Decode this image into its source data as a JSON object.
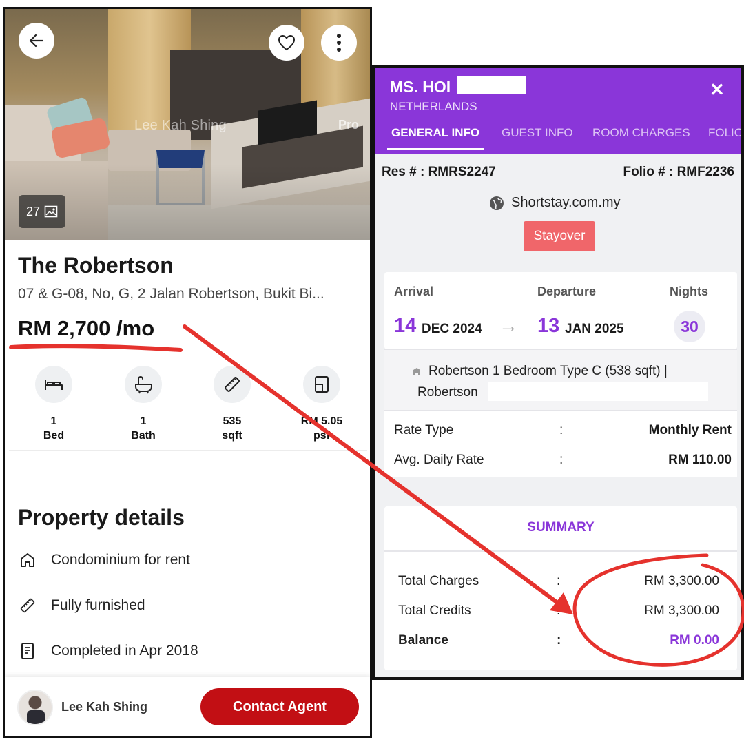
{
  "listing": {
    "photo_watermark": "Lee Kah Shing",
    "photo_brand": "Pro",
    "photo_count": "27",
    "title": "The Robertson",
    "address": "07 & G-08, No, G, 2 Jalan Robertson, Bukit Bi...",
    "price": "RM 2,700 /mo",
    "features": [
      {
        "icon": "bed-icon",
        "value": "1",
        "label": "Bed"
      },
      {
        "icon": "bath-icon",
        "value": "1",
        "label": "Bath"
      },
      {
        "icon": "ruler-icon",
        "value": "535",
        "label": "sqft"
      },
      {
        "icon": "floorplan-icon",
        "value": "RM 5.05",
        "label": "psf"
      }
    ],
    "details_heading": "Property details",
    "details": [
      {
        "icon": "home-icon",
        "text": "Condominium for rent"
      },
      {
        "icon": "ruler-icon",
        "text": "Fully furnished"
      },
      {
        "icon": "document-icon",
        "text": "Completed in Apr 2018"
      }
    ],
    "agent_name": "Lee Kah Shing",
    "contact_label": "Contact Agent"
  },
  "booking": {
    "guest_name": "MS. HOI",
    "guest_country": "NETHERLANDS",
    "close_label": "✕",
    "tabs": [
      "GENERAL INFO",
      "GUEST INFO",
      "ROOM CHARGES",
      "FOLIO"
    ],
    "active_tab": "GENERAL INFO",
    "res_no": "Res # : RMRS2247",
    "folio_no": "Folio # : RMF2236",
    "source": "Shortstay.com.my",
    "status": "Stayover",
    "arrival_label": "Arrival",
    "arrival_day": "14",
    "arrival_month": "DEC 2024",
    "departure_label": "Departure",
    "departure_day": "13",
    "departure_month": "JAN 2025",
    "nights_label": "Nights",
    "nights": "30",
    "room_line1": "Robertson 1 Bedroom Type C (538 sqft)  |",
    "room_line2": "Robertson",
    "rate_rows": [
      {
        "label": "Rate Type",
        "colon": ":",
        "value": "Monthly Rent"
      },
      {
        "label": "Avg. Daily Rate",
        "colon": ":",
        "value": "RM 110.00"
      }
    ],
    "summary_title": "SUMMARY",
    "summary_rows": [
      {
        "label": "Total Charges",
        "colon": ":",
        "value": "RM 3,300.00"
      },
      {
        "label": "Total Credits",
        "colon": ":",
        "value": "RM 3,300.00"
      },
      {
        "label": "Balance",
        "colon": ":",
        "value": "RM 0.00"
      }
    ]
  },
  "colors": {
    "brand_red": "#c20f14",
    "booking_purple": "#8a36d9",
    "status_red": "#f0666a",
    "annotation_red": "#e5322d"
  }
}
